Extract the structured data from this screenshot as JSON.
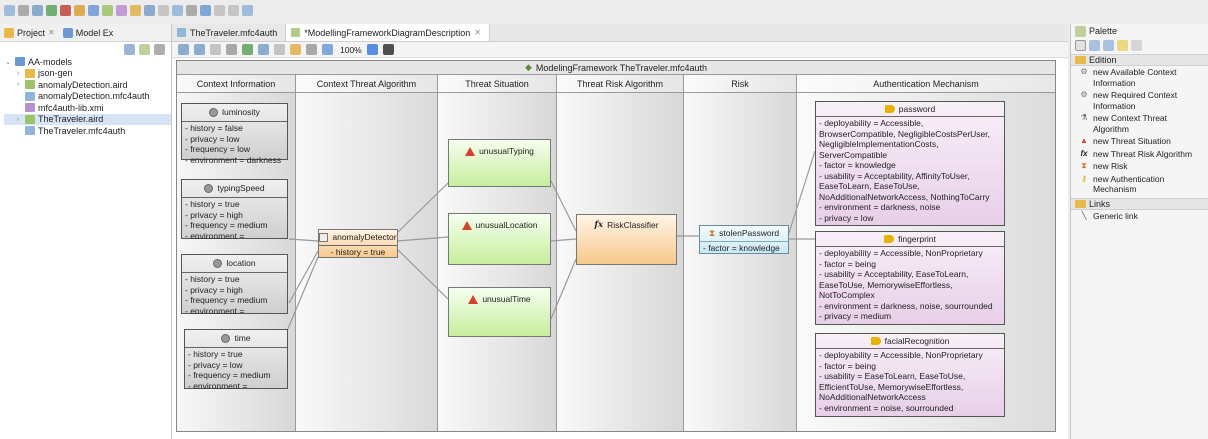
{
  "colors": {
    "situation": "#c6ee9c",
    "algorithm": "#f7c98c",
    "risk": "#cbe8f5",
    "auth": "#e8cfe8",
    "warning": "#d9402b",
    "selection": "#d6e4f5"
  },
  "left_panel": {
    "tabs": [
      {
        "label": "Project",
        "close": "✕"
      },
      {
        "label": "Model Ex",
        "close": ""
      }
    ],
    "tree": [
      {
        "label": "AA-models",
        "twisty": "⌄",
        "icon": "project-folder-icon"
      },
      {
        "label": "json-gen",
        "twisty": "›",
        "icon": "folder-icon"
      },
      {
        "label": "anomalyDetection.aird",
        "twisty": "›",
        "icon": "aird-file-icon"
      },
      {
        "label": "anomalyDetection.mfc4auth",
        "twisty": "",
        "icon": "model-file-icon"
      },
      {
        "label": "mfc4auth-lib.xmi",
        "twisty": "",
        "icon": "xmi-file-icon"
      },
      {
        "label": "TheTraveler.aird",
        "twisty": "›",
        "icon": "aird-file-icon"
      },
      {
        "label": "TheTraveler.mfc4auth",
        "twisty": "",
        "icon": "model-file-icon"
      }
    ]
  },
  "editor": {
    "tabs": [
      {
        "label": "TheTraveler.mfc4auth",
        "close": ""
      },
      {
        "label": "*ModellingFrameworkDiagramDescription",
        "close": "✕"
      }
    ],
    "zoom": "100%",
    "framework_title": "ModelingFramework TheTraveler.mfc4auth",
    "lanes": [
      "Context Information",
      "Context Threat Algorithm",
      "Threat Situation",
      "Threat Risk Algorithm",
      "Risk",
      "Authentication Mechanism"
    ],
    "context_nodes": [
      {
        "title": "luminosity",
        "attrs": [
          "- history = false",
          "- privacy = low",
          "- frequency = low",
          "- environment = darkness"
        ]
      },
      {
        "title": "typingSpeed",
        "attrs": [
          "- history = true",
          "- privacy = high",
          "- frequency = medium",
          "- environment ="
        ]
      },
      {
        "title": "location",
        "attrs": [
          "- history = true",
          "- privacy = high",
          "- frequency = medium",
          "- environment ="
        ]
      },
      {
        "title": "time",
        "attrs": [
          "- history = true",
          "- privacy = low",
          "- frequency = medium",
          "- environment ="
        ]
      }
    ],
    "context_algorithm": {
      "title": "anomalyDetector",
      "attr": "- history = true"
    },
    "situations": [
      "unusualTyping",
      "unusualLocation",
      "unusualTime"
    ],
    "risk_algorithm": {
      "prefix": "fx",
      "title": "RiskClassifier"
    },
    "risk": {
      "title": "stolenPassword",
      "attr": "- factor = knowledge"
    },
    "auth_nodes": [
      {
        "title": "password",
        "attrs": [
          "- deployability = Accessible,",
          "BrowserCompatible, NegligibleCostsPerUser,",
          "NegligibleImplementationCosts,",
          "ServerCompatible",
          "- factor = knowledge",
          "- usability = Acceptability, AffinityToUser,",
          "EaseToLearn, EaseToUse,",
          "NoAdditionalNetworkAccess, NothingToCarry",
          "- environment = darkness, noise",
          "- privacy = low"
        ]
      },
      {
        "title": "fingerprint",
        "attrs": [
          "- deployability = Accessible, NonProprietary",
          "- factor = being",
          "- usability = Acceptability, EaseToLearn,",
          "EaseToUse, MemorywiseEffortless,",
          "NotToComplex",
          "- environment = darkness, noise, sourrounded",
          "- privacy = medium"
        ]
      },
      {
        "title": "facialRecognition",
        "attrs": [
          "- deployability = Accessible, NonProprietary",
          "- factor = being",
          "- usability = EaseToLearn, EaseToUse,",
          "EfficientToUse, MemorywiseEffortless,",
          "NoAdditionalNetworkAccess",
          "- environment = noise, sourrounded"
        ]
      }
    ]
  },
  "palette": {
    "title": "Palette",
    "drawers": [
      {
        "label": "Edition",
        "items": [
          {
            "icon": "gear-icon",
            "glyph": "⚙",
            "label": "new Available Context Information"
          },
          {
            "icon": "gear-icon",
            "glyph": "⚙",
            "label": "new Required Context Information"
          },
          {
            "icon": "algorithm-icon",
            "glyph": "⚗",
            "label": "new Context Threat Algorithm"
          },
          {
            "icon": "warning-icon",
            "glyph": "▲",
            "label": "new Threat Situation"
          },
          {
            "icon": "fx-icon",
            "glyph": "fx",
            "label": "new Threat Risk Algorithm"
          },
          {
            "icon": "hourglass-icon",
            "glyph": "⧗",
            "label": "new Risk"
          },
          {
            "icon": "key-icon",
            "glyph": "⚷",
            "label": "new Authentication Mechanism"
          }
        ]
      },
      {
        "label": "Links",
        "items": [
          {
            "icon": "link-icon",
            "glyph": "╲",
            "label": "Generic link"
          }
        ]
      }
    ]
  }
}
